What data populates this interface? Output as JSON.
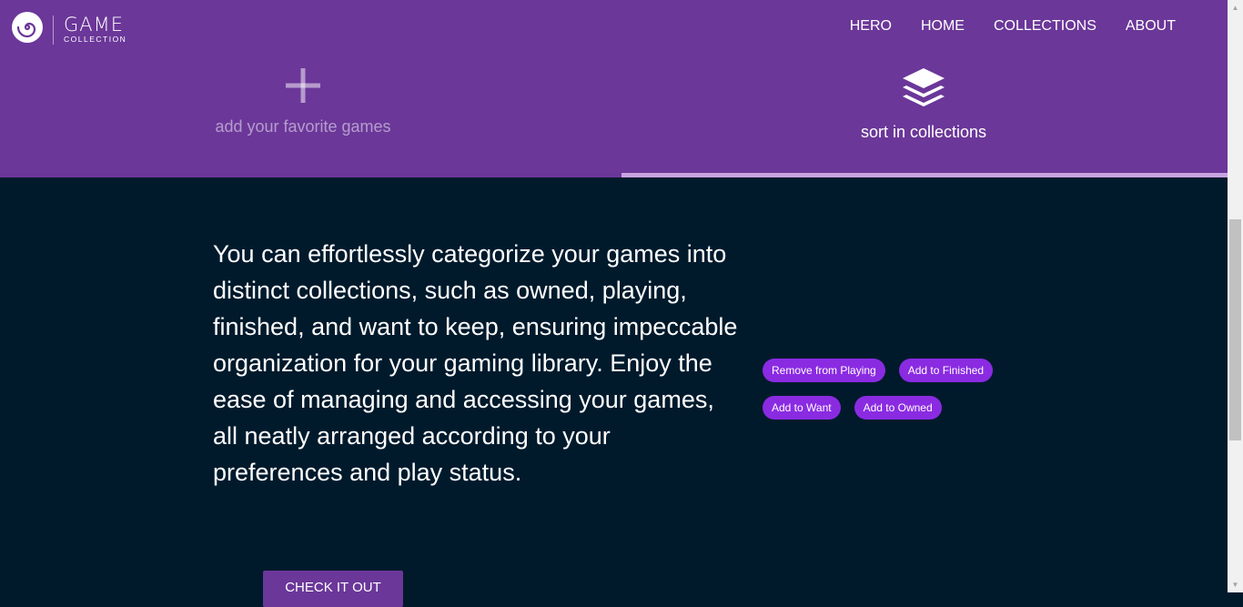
{
  "brand": {
    "title": "GAME",
    "subtitle": "COLLECTION"
  },
  "nav": {
    "items": [
      {
        "label": "HERO"
      },
      {
        "label": "HOME"
      },
      {
        "label": "COLLECTIONS"
      },
      {
        "label": "ABOUT"
      }
    ]
  },
  "features": {
    "add": {
      "label": "add your favorite games",
      "icon": "plus-icon"
    },
    "sort": {
      "label": "sort in collections",
      "icon": "layers-icon",
      "active": true
    }
  },
  "main": {
    "description": "You can effortlessly categorize your games into distinct collections, such as owned, playing, finished, and want to keep, ensuring impeccable organization for your gaming library. Enjoy the ease of managing and accessing your games, all neatly arranged according to your preferences and play status.",
    "actions": [
      {
        "label": "Remove from Playing"
      },
      {
        "label": "Add to Finished"
      },
      {
        "label": "Add to Want"
      },
      {
        "label": "Add to Owned"
      }
    ],
    "cta": "CHECK IT OUT"
  },
  "colors": {
    "hero_bg": "#6b3799",
    "page_bg": "#001a2c",
    "chip_bg": "#8a2be2",
    "tab_underline": "#c8a4e0"
  }
}
